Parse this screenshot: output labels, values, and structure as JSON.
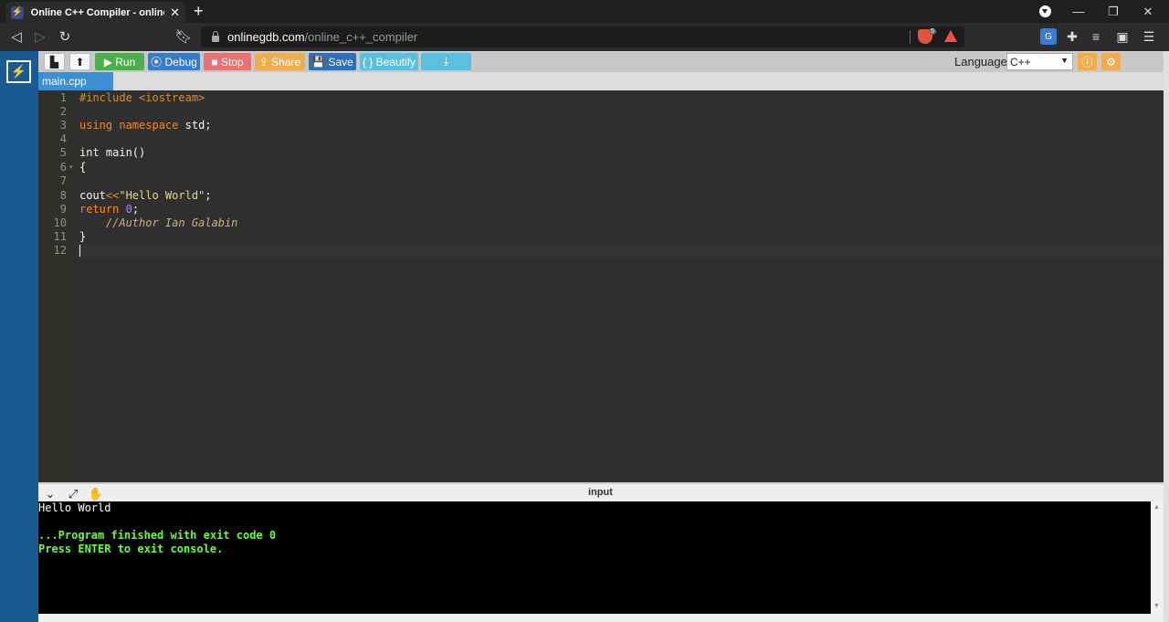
{
  "browser": {
    "tab_title": "Online C++ Compiler - online editor",
    "tab_close": "✕",
    "new_tab": "+",
    "url_host": "onlinegdb.com",
    "url_path": "/online_c++_compiler",
    "brave_count": "5",
    "window": {
      "minimize": "—",
      "restore": "❐",
      "close": "✕"
    }
  },
  "toolbar": {
    "run": "▶ Run",
    "debug": "⦿ Debug",
    "stop": "■ Stop",
    "share": "⇪ Share",
    "save": "💾 Save",
    "beautify": "{ } Beautify",
    "download": "⤓",
    "language_label": "Language",
    "language_value": "C++",
    "colors": {
      "run": "#4cae4c",
      "debug": "#3a7bc8",
      "stop": "#e57373",
      "share": "#f0ad4e",
      "save": "#2e6fb5",
      "beautify": "#5bc0de",
      "download": "#5bc0de",
      "info": "#f0ad4e",
      "settings": "#f0ad4e"
    }
  },
  "file_tab": "main.cpp",
  "editor": {
    "line_numbers": [
      "1",
      "2",
      "3",
      "4",
      "5",
      "6",
      "7",
      "8",
      "9",
      "10",
      "11",
      "12"
    ]
  },
  "console": {
    "title": "input",
    "lines": {
      "hello": "Hello World",
      "finished": "...Program finished with exit code 0",
      "press": "Press ENTER to exit console."
    }
  }
}
